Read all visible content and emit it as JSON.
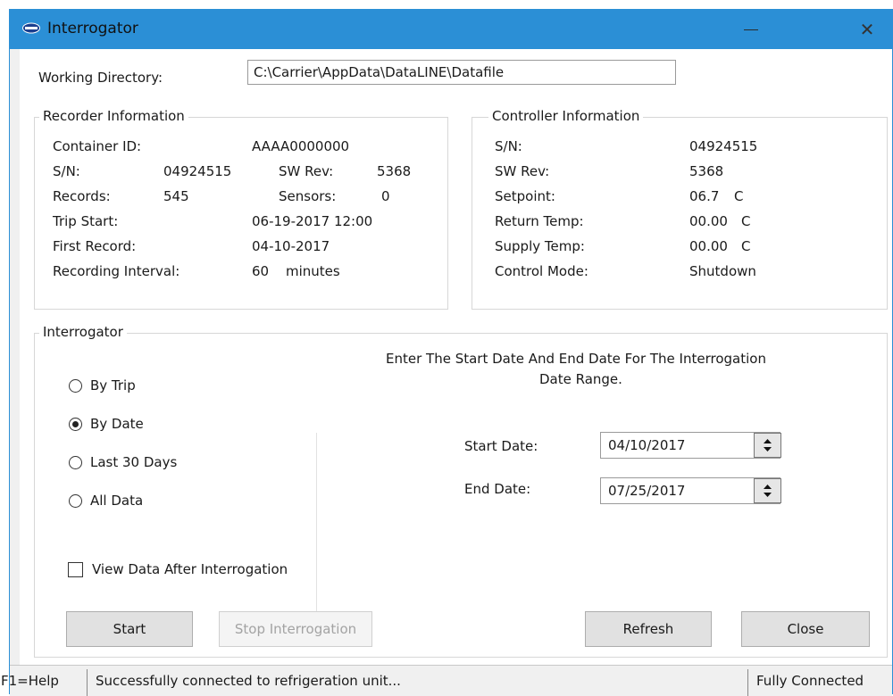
{
  "window": {
    "title": "Interrogator",
    "close_glyph": "✕"
  },
  "working_directory": {
    "label": "Working Directory:",
    "value": "C:\\Carrier\\AppData\\DataLINE\\Datafile"
  },
  "recorder": {
    "legend": "Recorder Information",
    "container_id_label": "Container ID:",
    "container_id_value": "AAAA0000000",
    "sn_label": "S/N:",
    "sn_value": "04924515",
    "swrev_label": "SW Rev:",
    "swrev_value": "5368",
    "records_label": "Records:",
    "records_value": "545",
    "sensors_label": "Sensors:",
    "sensors_value": "0",
    "trip_start_label": "Trip Start:",
    "trip_start_value": "06-19-2017 12:00",
    "first_record_label": "First Record:",
    "first_record_value": "04-10-2017",
    "interval_label": "Recording Interval:",
    "interval_value": "60",
    "interval_unit": "minutes"
  },
  "controller": {
    "legend": "Controller Information",
    "sn_label": "S/N:",
    "sn_value": "04924515",
    "swrev_label": "SW Rev:",
    "swrev_value": "5368",
    "setpoint_label": "Setpoint:",
    "setpoint_value": "06.7",
    "setpoint_unit": "C",
    "return_label": "Return Temp:",
    "return_value": "00.00",
    "return_unit": "C",
    "supply_label": "Supply Temp:",
    "supply_value": "00.00",
    "supply_unit": "C",
    "mode_label": "Control Mode:",
    "mode_value": "Shutdown"
  },
  "interrogator": {
    "legend": "Interrogator",
    "options": [
      {
        "label": "By Trip",
        "selected": false
      },
      {
        "label": "By Date",
        "selected": true
      },
      {
        "label": "Last 30 Days",
        "selected": false
      },
      {
        "label": "All Data",
        "selected": false
      }
    ],
    "instruction_line1": "Enter The Start Date And End Date For The Interrogation",
    "instruction_line2": "Date Range.",
    "start_date_label": "Start Date:",
    "start_date_value": "04/10/2017",
    "end_date_label": "End Date:",
    "end_date_value": "07/25/2017",
    "view_data_label": "View Data After Interrogation",
    "view_data_checked": false
  },
  "buttons": {
    "start": "Start",
    "stop": "Stop Interrogation",
    "refresh": "Refresh",
    "close": "Close"
  },
  "statusbar": {
    "help": "F1=Help",
    "message": "Successfully connected to refrigeration unit...",
    "connection": "Fully Connected"
  }
}
